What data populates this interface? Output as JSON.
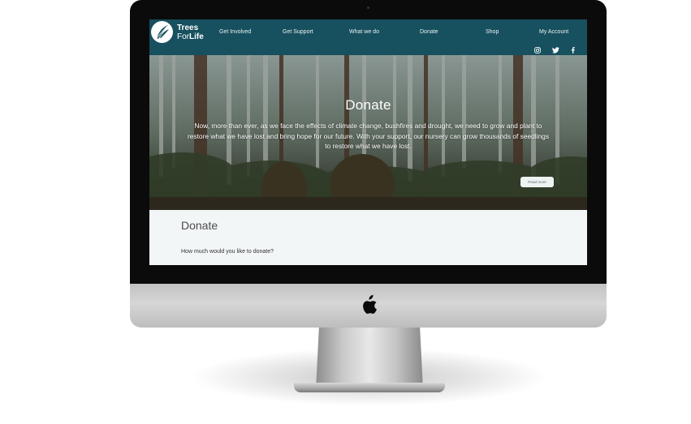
{
  "logo": {
    "line1": "Trees",
    "line2_a": "For",
    "line2_b": "Life"
  },
  "nav": {
    "items": [
      {
        "label": "Get Involved"
      },
      {
        "label": "Get Support"
      },
      {
        "label": "What we do"
      },
      {
        "label": "Donate"
      },
      {
        "label": "Shop"
      },
      {
        "label": "My Account"
      }
    ]
  },
  "social": [
    {
      "icon": "instagram-icon"
    },
    {
      "icon": "twitter-icon"
    },
    {
      "icon": "facebook-icon"
    }
  ],
  "hero": {
    "title": "Donate",
    "text": "Now, more than ever, as we face the effects of climate change, bushfires and drought, we need to grow and plant to restore what we have lost and bring hope for our future. With your support, our nursery can grow thousands of seedlings to restore what we have lost.",
    "read_more": "Read more"
  },
  "content": {
    "title": "Donate",
    "question": "How much would you like to donate?"
  },
  "colors": {
    "header": "#17505e",
    "content_bg": "#f3f6f7"
  }
}
